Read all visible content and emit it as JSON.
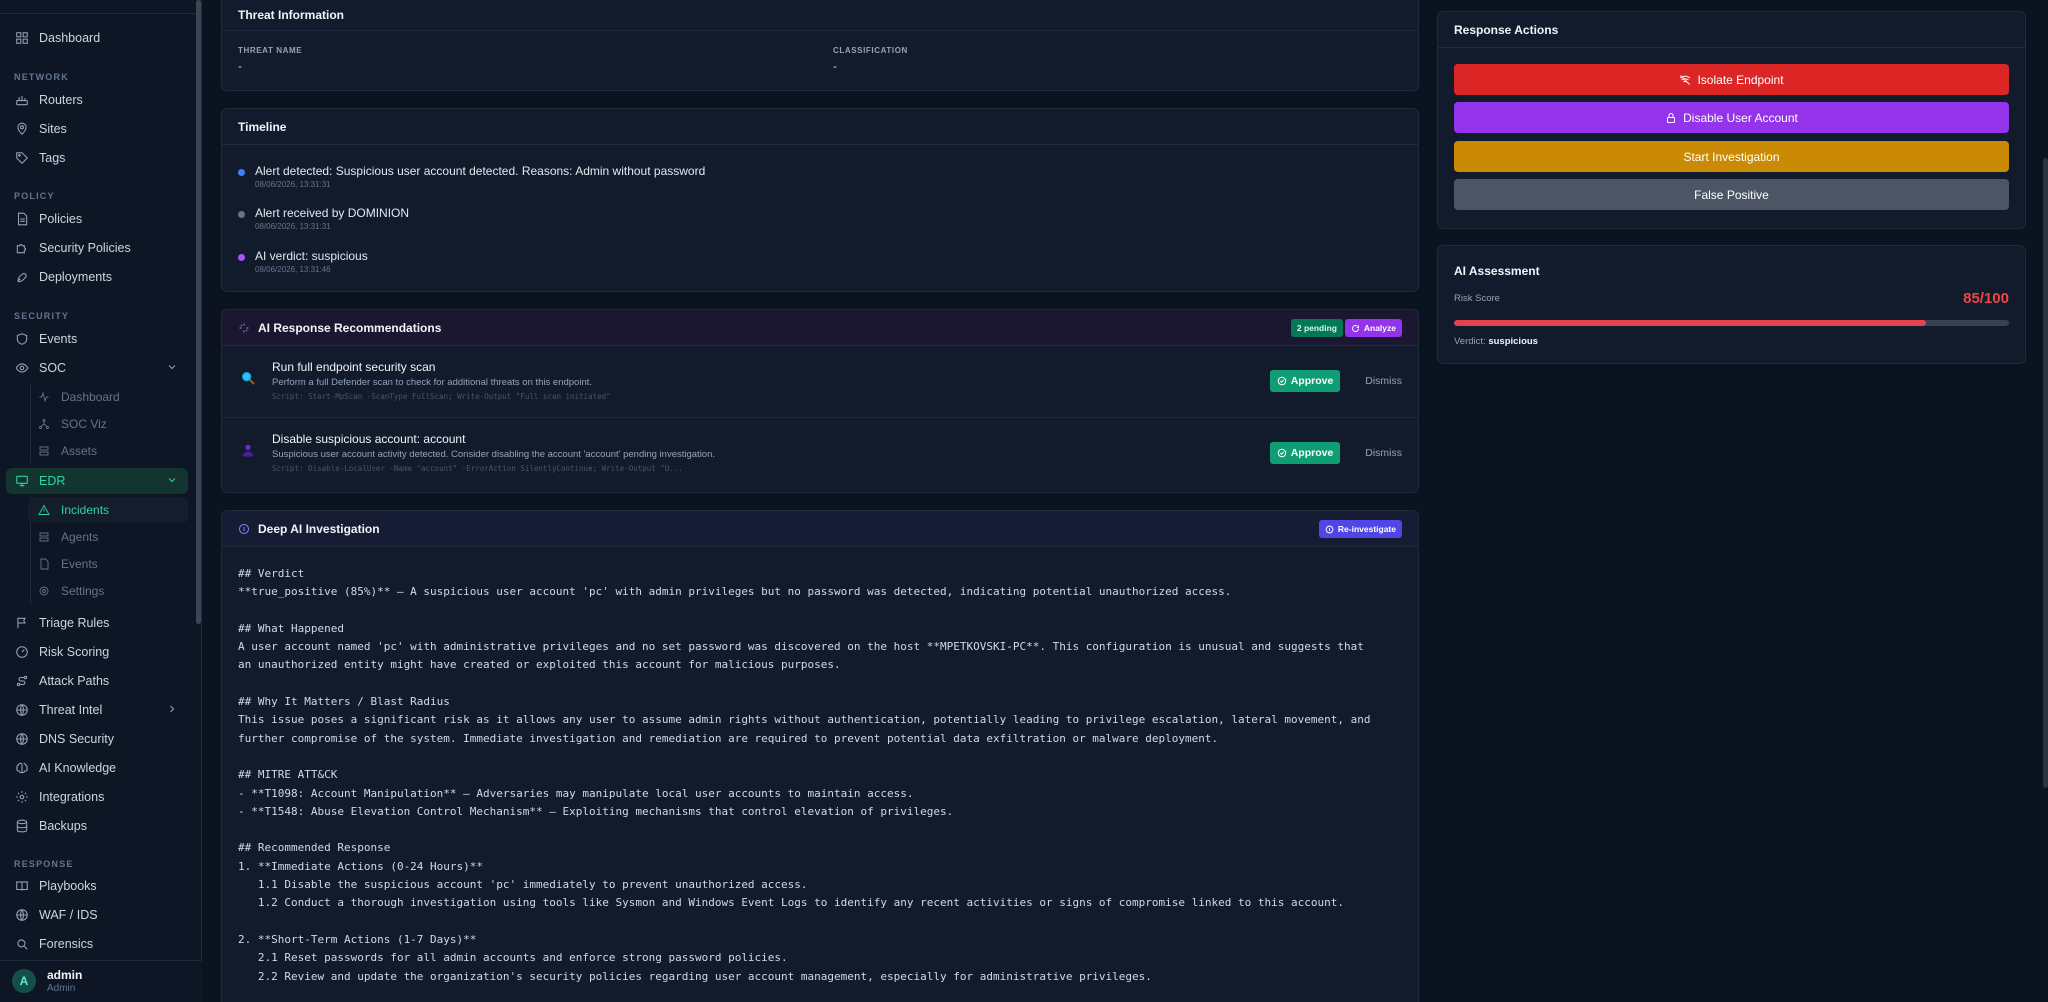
{
  "sidebar": {
    "sections": [
      "NETWORK",
      "POLICY",
      "SECURITY",
      "RESPONSE"
    ],
    "items": [
      {
        "label": "Dashboard",
        "icon": "layout-icon"
      },
      {
        "label": "Routers",
        "icon": "router-icon"
      },
      {
        "label": "Sites",
        "icon": "map-pin-icon"
      },
      {
        "label": "Tags",
        "icon": "tag-icon"
      },
      {
        "label": "Policies",
        "icon": "file-icon"
      },
      {
        "label": "Security Policies",
        "icon": "puzzle-icon"
      },
      {
        "label": "Deployments",
        "icon": "rocket-icon"
      },
      {
        "label": "Events",
        "icon": "shield-icon"
      },
      {
        "label": "SOC",
        "icon": "eye-icon"
      },
      {
        "label": "EDR",
        "icon": "monitor-icon"
      },
      {
        "label": "Triage Rules",
        "icon": "flag-icon"
      },
      {
        "label": "Risk Scoring",
        "icon": "gauge-icon"
      },
      {
        "label": "Attack Paths",
        "icon": "route-icon"
      },
      {
        "label": "Threat Intel",
        "icon": "globe-icon"
      },
      {
        "label": "DNS Security",
        "icon": "globe-icon"
      },
      {
        "label": "AI Knowledge",
        "icon": "brain-icon"
      },
      {
        "label": "Integrations",
        "icon": "gear-icon"
      },
      {
        "label": "Backups",
        "icon": "database-icon"
      },
      {
        "label": "Playbooks",
        "icon": "book-icon"
      },
      {
        "label": "WAF / IDS",
        "icon": "globe-icon"
      },
      {
        "label": "Forensics",
        "icon": "search-icon"
      }
    ],
    "soc_sub": [
      "Dashboard",
      "SOC Viz",
      "Assets"
    ],
    "edr_sub": [
      "Incidents",
      "Agents",
      "Events",
      "Settings"
    ],
    "user": {
      "initial": "A",
      "name": "admin",
      "role": "Admin"
    }
  },
  "threat_info": {
    "title": "Threat Information",
    "threat_name_label": "THREAT NAME",
    "threat_name": "-",
    "classification_label": "CLASSIFICATION",
    "classification": "-"
  },
  "timeline": {
    "title": "Timeline",
    "entries": [
      {
        "text": "Alert detected: Suspicious user account detected. Reasons: Admin without password",
        "time": "08/06/2026, 13:31:31",
        "color": "#3b82f6"
      },
      {
        "text": "Alert received by DOMINION",
        "time": "08/06/2026, 13:31:31",
        "color": "#6b7280"
      },
      {
        "text": "AI verdict: suspicious",
        "time": "08/06/2026, 13:31:46",
        "color": "#a855f7"
      }
    ]
  },
  "recommendations": {
    "title": "AI Response Recommendations",
    "pending": "2 pending",
    "analyze": "Analyze",
    "approve": "Approve",
    "dismiss": "Dismiss",
    "items": [
      {
        "icon": "magnifier-icon",
        "title": "Run full endpoint security scan",
        "desc": "Perform a full Defender scan to check for additional threats on this endpoint.",
        "script": "Script: Start-MpScan -ScanType FullScan; Write-Output \"Full scan initiated\""
      },
      {
        "icon": "user-icon",
        "title": "Disable suspicious account: account",
        "desc": "Suspicious user account activity detected. Consider disabling the account 'account' pending investigation.",
        "script": "Script: Disable-LocalUser -Name \"account\" -ErrorAction SilentlyContinue; Write-Output \"U..."
      }
    ]
  },
  "investigation": {
    "title": "Deep AI Investigation",
    "reinvestigate": "Re-investigate",
    "lines": [
      "## Verdict",
      "**true_positive (85%)** — A suspicious user account 'pc' with admin privileges but no password was detected, indicating potential unauthorized access.",
      "",
      "## What Happened",
      "A user account named 'pc' with administrative privileges and no set password was discovered on the host **MPETKOVSKI-PC**. This configuration is unusual and suggests that",
      "an unauthorized entity might have created or exploited this account for malicious purposes.",
      "",
      "## Why It Matters / Blast Radius",
      "This issue poses a significant risk as it allows any user to assume admin rights without authentication, potentially leading to privilege escalation, lateral movement, and",
      "further compromise of the system. Immediate investigation and remediation are required to prevent potential data exfiltration or malware deployment.",
      "",
      "## MITRE ATT&CK",
      "- **T1098: Account Manipulation** — Adversaries may manipulate local user accounts to maintain access.",
      "- **T1548: Abuse Elevation Control Mechanism** — Exploiting mechanisms that control elevation of privileges.",
      "",
      "## Recommended Response",
      "1. **Immediate Actions (0-24 Hours)**",
      "   1.1 Disable the suspicious account 'pc' immediately to prevent unauthorized access.",
      "   1.2 Conduct a thorough investigation using tools like Sysmon and Windows Event Logs to identify any recent activities or signs of compromise linked to this account.",
      "",
      "2. **Short-Term Actions (1-7 Days)**",
      "   2.1 Reset passwords for all admin accounts and enforce strong password policies.",
      "   2.2 Review and update the organization's security policies regarding user account management, especially for administrative privileges."
    ]
  },
  "response_actions": {
    "title": "Response Actions",
    "buttons": [
      {
        "label": "Isolate Endpoint",
        "color": "#dc2626",
        "icon": "wifi-off-icon"
      },
      {
        "label": "Disable User Account",
        "color": "#9333ea",
        "icon": "lock-icon"
      },
      {
        "label": "Start Investigation",
        "color": "#ca8a04",
        "icon": ""
      },
      {
        "label": "False Positive",
        "color": "#4b5563",
        "icon": ""
      }
    ]
  },
  "assessment": {
    "title": "AI Assessment",
    "risk_label": "Risk Score",
    "risk_score": "85/100",
    "risk_fraction": 0.85,
    "verdict_label": "Verdict:",
    "verdict": "suspicious"
  }
}
